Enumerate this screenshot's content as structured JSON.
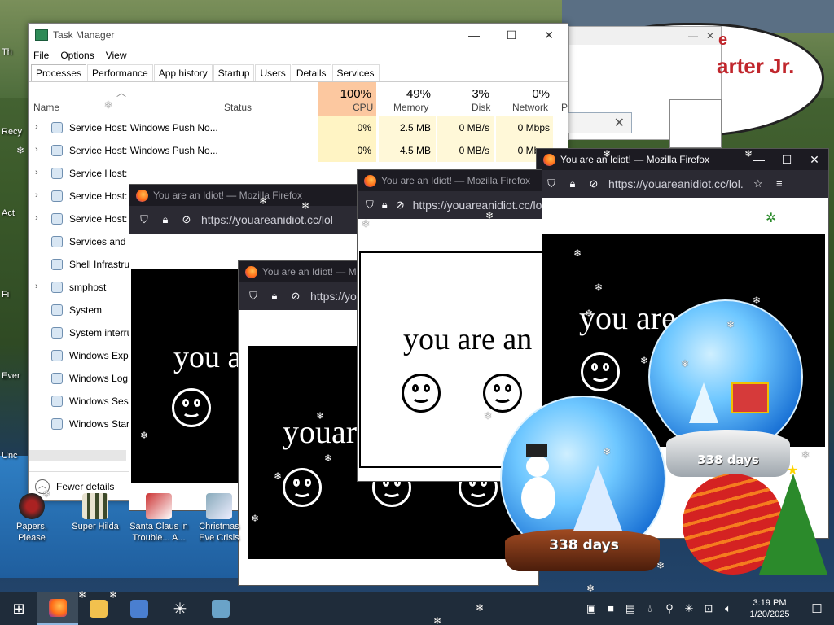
{
  "desktop": {
    "icons": [
      {
        "label": "Papers, Please"
      },
      {
        "label": "Super Hilda"
      },
      {
        "label": "Santa Claus in Trouble... A..."
      },
      {
        "label": "Christmas Eve Crisis"
      }
    ],
    "side_labels": [
      "Th",
      "Recy",
      "Act",
      "Fi",
      "Ever",
      "Unc"
    ],
    "bubble_text": "arter Jr.",
    "bubble_letter": "e"
  },
  "task_manager": {
    "title": "Task Manager",
    "menu": [
      "File",
      "Options",
      "View"
    ],
    "tabs": [
      "Processes",
      "Performance",
      "App history",
      "Startup",
      "Users",
      "Details",
      "Services"
    ],
    "active_tab": "Processes",
    "columns": {
      "name": "Name",
      "status": "Status",
      "cpu": {
        "pct": "100%",
        "label": "CPU"
      },
      "memory": {
        "pct": "49%",
        "label": "Memory"
      },
      "disk": {
        "pct": "3%",
        "label": "Disk"
      },
      "network": {
        "pct": "0%",
        "label": "Network"
      },
      "power": "P"
    },
    "rows": [
      {
        "name": "Service Host: Windows Push No...",
        "cpu": "0%",
        "memory": "2.5 MB",
        "disk": "0 MB/s",
        "network": "0 Mbps",
        "expand": "›"
      },
      {
        "name": "Service Host: Windows Push No...",
        "cpu": "0%",
        "memory": "4.5 MB",
        "disk": "0 MB/s",
        "network": "0 Mbps",
        "expand": "›"
      },
      {
        "name": "Service Host:",
        "cpu": "",
        "memory": "",
        "disk": "",
        "network": "",
        "expand": "›"
      },
      {
        "name": "Service Host:",
        "cpu": "",
        "memory": "",
        "disk": "",
        "network": "",
        "expand": "›"
      },
      {
        "name": "Service Host:",
        "cpu": "",
        "memory": "",
        "disk": "",
        "network": "",
        "expand": "›"
      },
      {
        "name": "Services and C",
        "cpu": "",
        "memory": "",
        "disk": "",
        "network": "",
        "expand": ""
      },
      {
        "name": "Shell Infrastru",
        "cpu": "",
        "memory": "",
        "disk": "",
        "network": "",
        "expand": ""
      },
      {
        "name": "smphost",
        "cpu": "",
        "memory": "",
        "disk": "",
        "network": "",
        "expand": "›"
      },
      {
        "name": "System",
        "cpu": "",
        "memory": "",
        "disk": "",
        "network": "",
        "expand": ""
      },
      {
        "name": "System interru",
        "cpu": "",
        "memory": "",
        "disk": "",
        "network": "",
        "expand": ""
      },
      {
        "name": "Windows Expl",
        "cpu": "",
        "memory": "",
        "disk": "",
        "network": "",
        "expand": ""
      },
      {
        "name": "Windows Log",
        "cpu": "",
        "memory": "",
        "disk": "",
        "network": "",
        "expand": ""
      },
      {
        "name": "Windows Sess",
        "cpu": "",
        "memory": "",
        "disk": "",
        "network": "",
        "expand": ""
      },
      {
        "name": "Windows Star",
        "cpu": "",
        "memory": "",
        "disk": "",
        "network": "",
        "expand": ""
      }
    ],
    "fewer_details": "Fewer details"
  },
  "firefox": {
    "title": "You are an Idiot! — Mozilla Firefox",
    "url": "https://youareanidiot.cc/lol",
    "url_short": "https://youareanidiot.cc/lol.",
    "url_trunc": "https://youareanidiot.cc/lol",
    "page_text": "you are an idiot",
    "page_text_partial_1": "you a",
    "page_text_partial_2": "youar",
    "page_text_partial_3": "you are an",
    "page_text_partial_4": "you are"
  },
  "globes": {
    "days_label": "338 days"
  },
  "taskbar": {
    "time": "3:19 PM",
    "date": "1/20/2025"
  },
  "colors": {
    "taskbar": "#1f2c3a",
    "firefox_chrome": "#1c1b22",
    "firefox_nav": "#2b2a33",
    "cpu_header": "#fcc8a0",
    "cpu_cells": "#fff4c4"
  }
}
